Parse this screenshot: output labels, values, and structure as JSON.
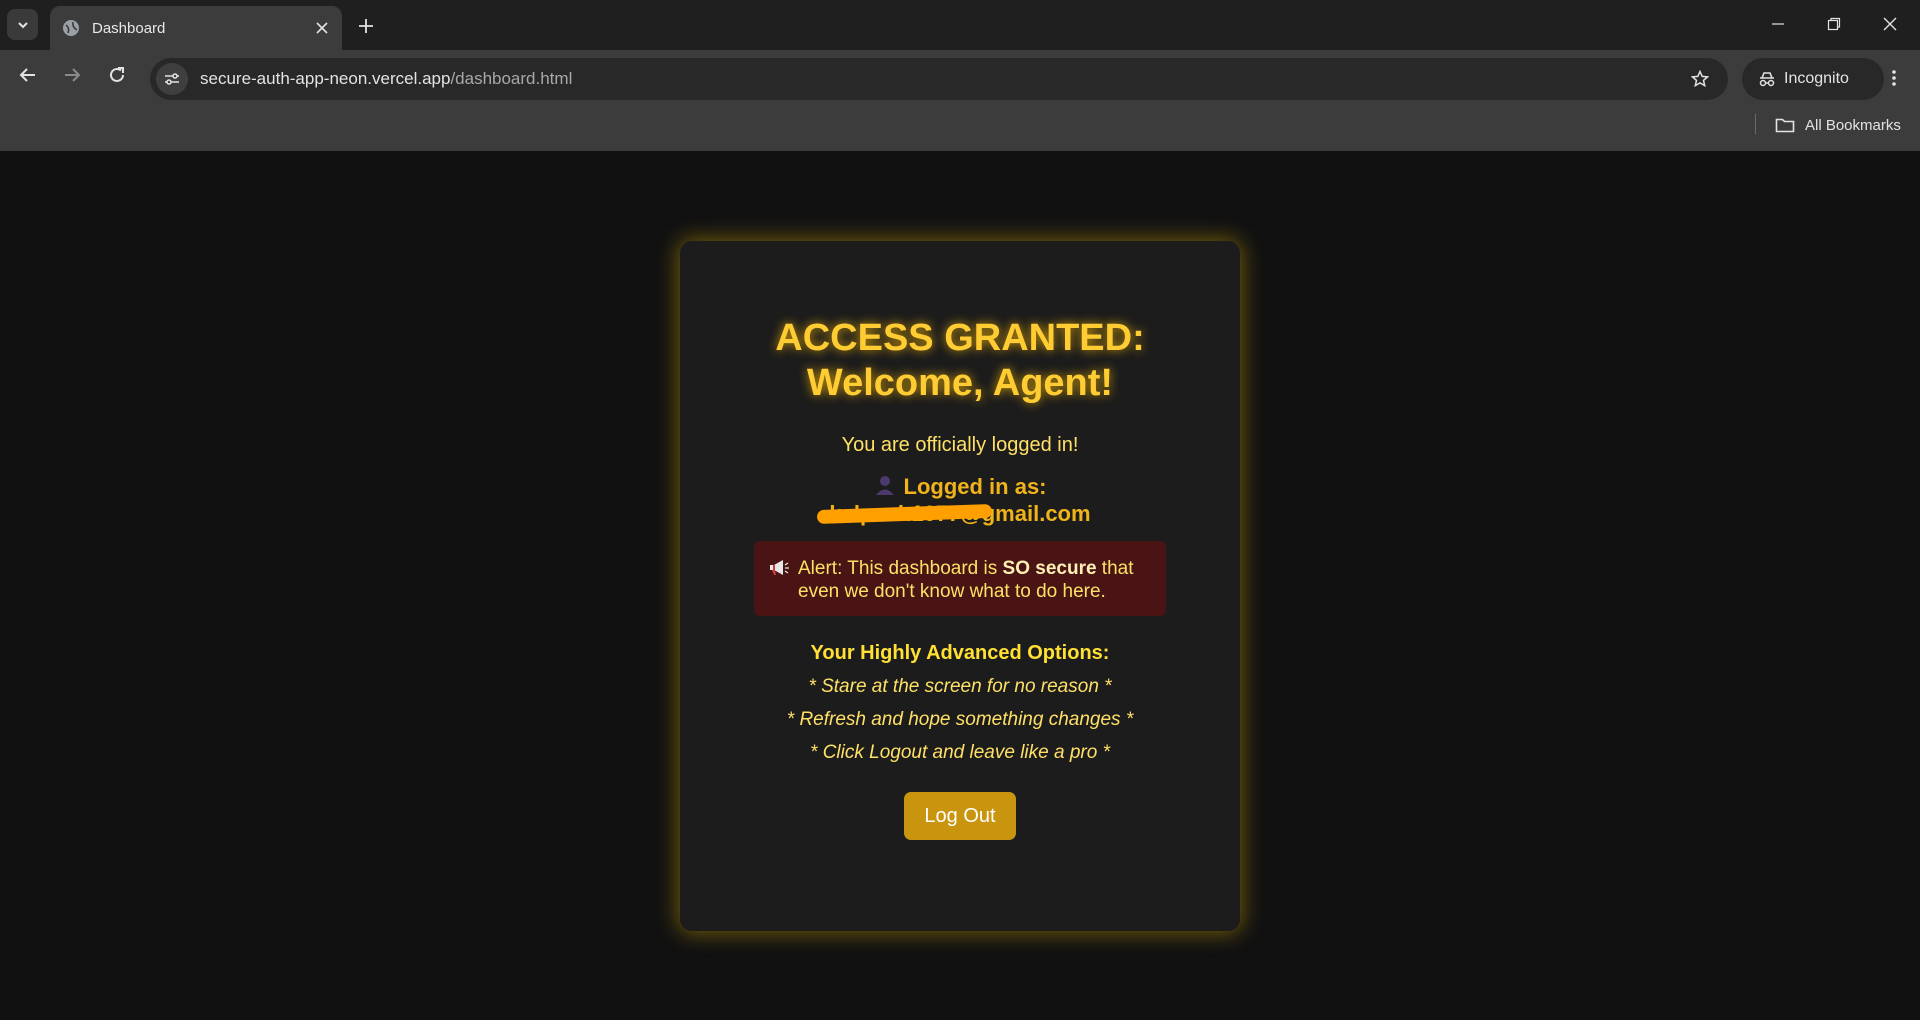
{
  "browser": {
    "tab_title": "Dashboard",
    "url_host": "secure-auth-app-neon.vercel.app",
    "url_path": "/dashboard.html",
    "incognito_label": "Incognito",
    "all_bookmarks_label": "All Bookmarks"
  },
  "page": {
    "heading_line1": "ACCESS GRANTED:",
    "heading_line2": "Welcome, Agent!",
    "subtitle": "You are officially logged in!",
    "logged_in_label": "Logged in as:",
    "email": "kalpesh1077@gmail.com",
    "alert": {
      "prefix": "Alert: This dashboard is ",
      "emphasis": "SO secure",
      "suffix": " that even we don't know what to do here."
    },
    "options_title": "Your Highly Advanced Options:",
    "options": [
      "* Stare at the screen for no reason *",
      "* Refresh and hope something changes *",
      "* Click Logout and leave like a pro *"
    ],
    "logout_label": "Log Out"
  },
  "colors": {
    "accent": "#ffcc33",
    "button": "#c9950f",
    "alert_bg": "#4a1414",
    "background": "#111111"
  },
  "icons": [
    "chevron-down-icon",
    "globe-icon",
    "close-icon",
    "plus-icon",
    "minimize-icon",
    "restore-icon",
    "back-icon",
    "forward-icon",
    "reload-icon",
    "site-info-icon",
    "star-icon",
    "incognito-icon",
    "more-icon",
    "folder-icon",
    "user-icon",
    "megaphone-icon"
  ]
}
